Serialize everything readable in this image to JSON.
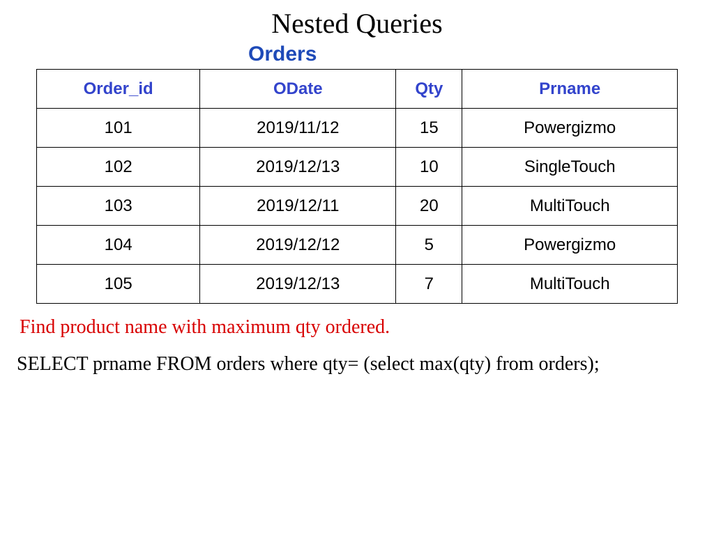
{
  "title": "Nested Queries",
  "table_title": "Orders",
  "headers": {
    "c0": "Order_id",
    "c1": "ODate",
    "c2": "Qty",
    "c3": "Prname"
  },
  "rows": [
    {
      "order_id": "101",
      "odate": "2019/11/12",
      "qty": "15",
      "prname": "Powergizmo"
    },
    {
      "order_id": "102",
      "odate": "2019/12/13",
      "qty": "10",
      "prname": "SingleTouch"
    },
    {
      "order_id": "103",
      "odate": "2019/12/11",
      "qty": "20",
      "prname": "MultiTouch"
    },
    {
      "order_id": "104",
      "odate": "2019/12/12",
      "qty": "5",
      "prname": "Powergizmo"
    },
    {
      "order_id": "105",
      "odate": "2019/12/13",
      "qty": "7",
      "prname": "MultiTouch"
    }
  ],
  "prompt": "Find product name with maximum qty ordered.",
  "sql": "SELECT prname FROM orders where qty= (select max(qty) from orders);",
  "chart_data": {
    "type": "table",
    "title": "Orders",
    "columns": [
      "Order_id",
      "ODate",
      "Qty",
      "Prname"
    ],
    "data": [
      [
        101,
        "2019/11/12",
        15,
        "Powergizmo"
      ],
      [
        102,
        "2019/12/13",
        10,
        "SingleTouch"
      ],
      [
        103,
        "2019/12/11",
        20,
        "MultiTouch"
      ],
      [
        104,
        "2019/12/12",
        5,
        "Powergizmo"
      ],
      [
        105,
        "2019/12/13",
        7,
        "MultiTouch"
      ]
    ]
  }
}
